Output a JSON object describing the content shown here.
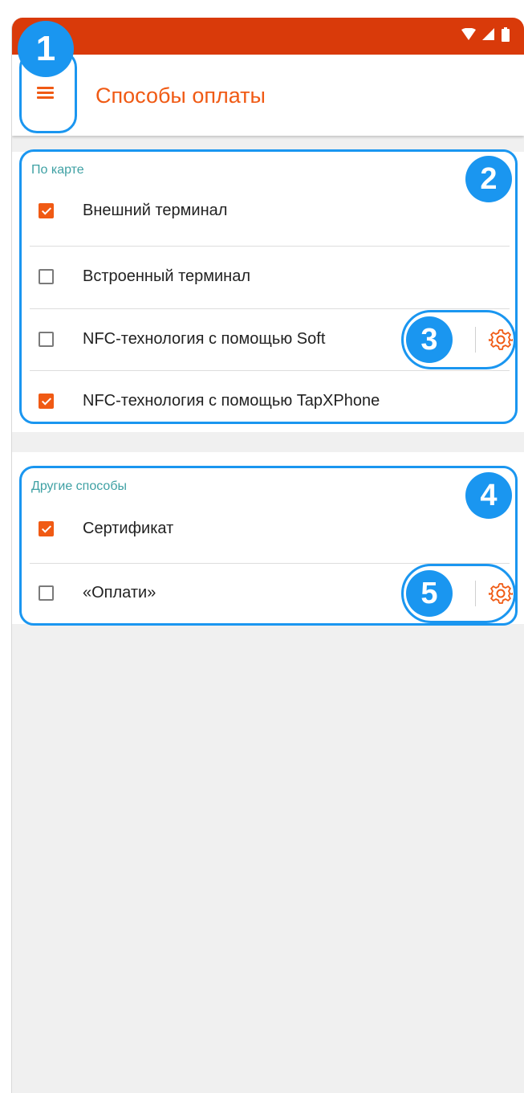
{
  "app": {
    "title": "Способы оплаты",
    "accent_color": "#f05a14",
    "statusbar_color": "#d93a0a",
    "section_color": "#3fa1a4",
    "annotation_color": "#1a96f0"
  },
  "statusbar": {
    "icons": [
      "wifi-icon",
      "signal-icon",
      "battery-icon"
    ]
  },
  "sections": [
    {
      "title": "По карте",
      "items": [
        {
          "label": "Внешний терминал",
          "checked": true,
          "has_settings": false
        },
        {
          "label": "Встроенный терминал",
          "checked": false,
          "has_settings": false
        },
        {
          "label": "NFC-технология с помощью Soft",
          "checked": false,
          "has_settings": true
        },
        {
          "label": "NFC-технология с помощью TapXPhone",
          "checked": true,
          "has_settings": false
        }
      ]
    },
    {
      "title": "Другие способы",
      "items": [
        {
          "label": "Сертификат",
          "checked": true,
          "has_settings": false
        },
        {
          "label": "«Оплати»",
          "checked": false,
          "has_settings": true
        }
      ]
    }
  ],
  "annotations": [
    "1",
    "2",
    "3",
    "4",
    "5"
  ]
}
